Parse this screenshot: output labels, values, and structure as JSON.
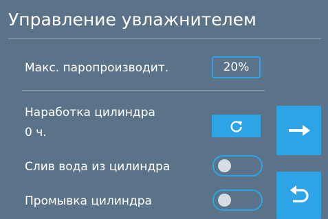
{
  "header": {
    "title": "Управление увлажнителем"
  },
  "max_steam": {
    "label": "Макс. паропроизводит.",
    "value": "20%"
  },
  "cylinder_hours": {
    "label_line1": "Наработка цилиндра",
    "label_line2": "0 ч.",
    "reset_icon": "refresh-icon"
  },
  "drain": {
    "label": "Слив вода из цилиндра",
    "state": "off"
  },
  "flush": {
    "label": "Промывка цилиндра",
    "state": "off"
  },
  "nav": {
    "next_icon": "arrow-right-icon",
    "back_icon": "return-icon"
  },
  "colors": {
    "background": "#5a7388",
    "accent": "#2da4e6",
    "text": "#ffffff"
  }
}
